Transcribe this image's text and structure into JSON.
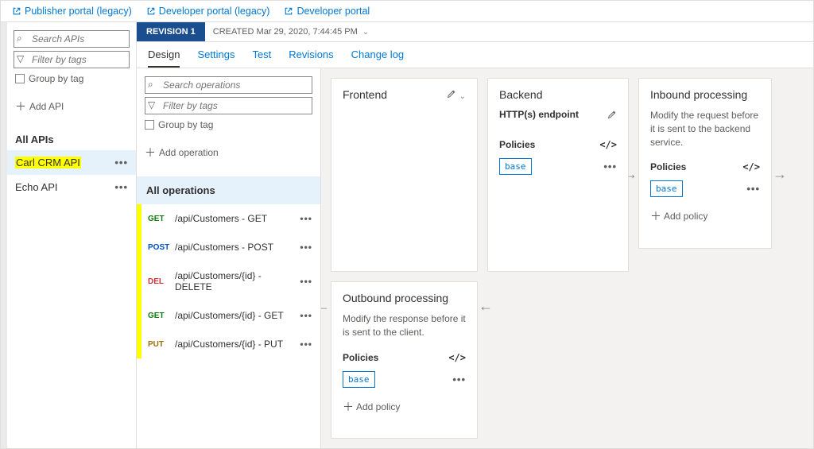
{
  "portal_links": {
    "publisher": "Publisher portal (legacy)",
    "developer_legacy": "Developer portal (legacy)",
    "developer": "Developer portal"
  },
  "sidebar": {
    "search_placeholder": "Search APIs",
    "filter_placeholder": "Filter by tags",
    "group_by_tag": "Group by tag",
    "add_api": "Add API",
    "all_apis": "All APIs",
    "apis": [
      {
        "name": "Carl CRM API",
        "highlighted": true,
        "selected": true
      },
      {
        "name": "Echo API",
        "highlighted": false,
        "selected": false
      }
    ]
  },
  "revision": {
    "badge": "REVISION 1",
    "created": "CREATED Mar 29, 2020, 7:44:45 PM"
  },
  "tabs": [
    "Design",
    "Settings",
    "Test",
    "Revisions",
    "Change log"
  ],
  "active_tab": "Design",
  "ops": {
    "search_placeholder": "Search operations",
    "filter_placeholder": "Filter by tags",
    "group_by_tag": "Group by tag",
    "add_operation": "Add operation",
    "all_operations": "All operations",
    "items": [
      {
        "verb": "GET",
        "label": "/api/Customers - GET"
      },
      {
        "verb": "POST",
        "label": "/api/Customers - POST"
      },
      {
        "verb": "DEL",
        "label": "/api/Customers/{id} - DELETE"
      },
      {
        "verb": "GET",
        "label": "/api/Customers/{id} - GET"
      },
      {
        "verb": "PUT",
        "label": "/api/Customers/{id} - PUT"
      }
    ]
  },
  "frontend": {
    "title": "Frontend"
  },
  "inbound": {
    "title": "Inbound processing",
    "desc": "Modify the request before it is sent to the backend service.",
    "policies": "Policies",
    "base": "base",
    "add_policy": "Add policy"
  },
  "outbound": {
    "title": "Outbound processing",
    "desc": "Modify the response before it is sent to the client.",
    "policies": "Policies",
    "base": "base",
    "add_policy": "Add policy"
  },
  "backend": {
    "title": "Backend",
    "endpoint": "HTTP(s) endpoint",
    "policies": "Policies",
    "base": "base"
  }
}
